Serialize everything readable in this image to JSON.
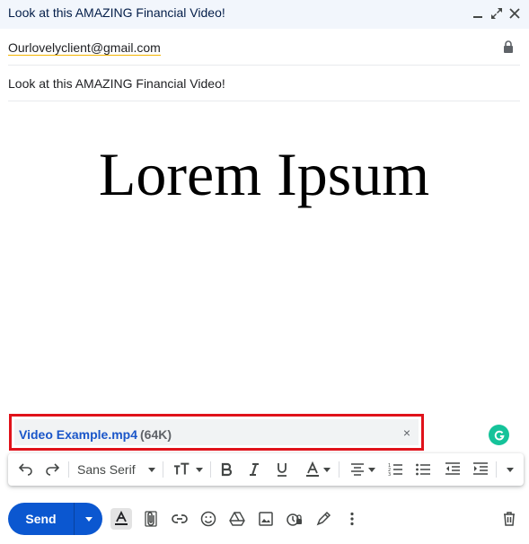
{
  "window": {
    "title": "Look at this AMAZING Financial Video!"
  },
  "recipients": {
    "to": "Ourlovelyclient@gmail.com"
  },
  "subject": {
    "value": "Look at this AMAZING Financial Video!"
  },
  "body": {
    "heading": "Lorem Ipsum"
  },
  "attachment": {
    "name": "Video Example.mp4",
    "size": "(64K)",
    "remove_symbol": "×"
  },
  "toolbar": {
    "font": "Sans Serif"
  },
  "bottom": {
    "send_label": "Send"
  },
  "colors": {
    "accent": "#0b57d0",
    "attachment_highlight": "#e0121a",
    "attachment_link": "#1a56c9",
    "grammarly": "#15c39a"
  },
  "icons": {
    "titlebar": [
      "minimize-icon",
      "popout-icon",
      "close-icon"
    ],
    "toolbar": [
      "undo-icon",
      "redo-icon",
      "text-size-icon",
      "bold-icon",
      "italic-icon",
      "underline-icon",
      "text-color-icon",
      "align-icon",
      "numbered-list-icon",
      "bulleted-list-icon",
      "indent-less-icon",
      "indent-more-icon",
      "more-formatting-icon"
    ],
    "bottom": [
      "formatting-toggle-icon",
      "attach-file-icon",
      "insert-link-icon",
      "emoji-icon",
      "drive-icon",
      "insert-photo-icon",
      "confidential-mode-icon",
      "signature-icon",
      "more-options-icon",
      "discard-draft-icon"
    ]
  }
}
